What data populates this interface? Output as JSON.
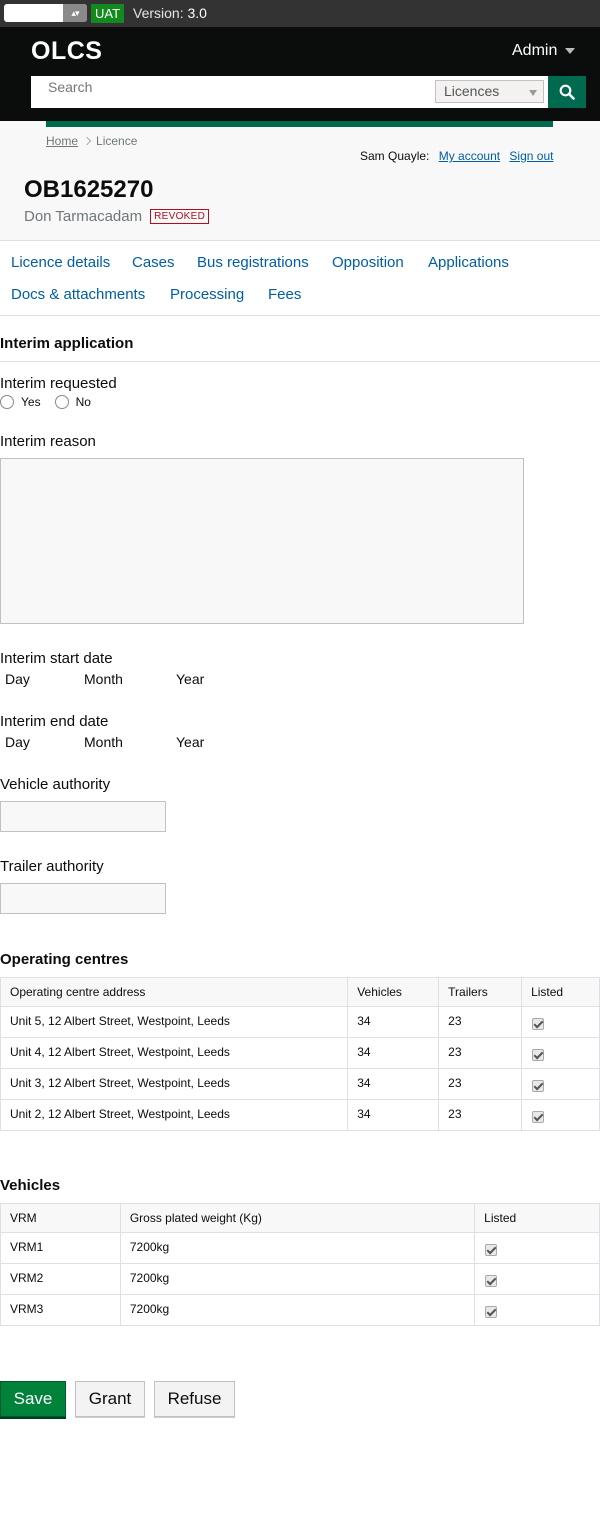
{
  "env": {
    "badge": "UAT",
    "version_label": "Version:",
    "version": "3.0"
  },
  "header": {
    "logo": "OLCS",
    "admin_label": "Admin",
    "search": {
      "placeholder": "Search",
      "scope": "Licences"
    }
  },
  "breadcrumb": {
    "home": "Home",
    "current": "Licence"
  },
  "user": {
    "name": "Sam Quayle:",
    "my_account": "My account",
    "sign_out": "Sign out"
  },
  "licence": {
    "number": "OB1625270",
    "operator": "Don Tarmacadam",
    "status": "REVOKED"
  },
  "tabs": [
    "Licence details",
    "Cases",
    "Bus registrations",
    "Opposition",
    "Applications",
    "Docs & attachments",
    "Processing",
    "Fees"
  ],
  "form": {
    "section_title": "Interim application",
    "interim_requested": {
      "label": "Interim requested",
      "yes": "Yes",
      "no": "No"
    },
    "interim_reason": {
      "label": "Interim reason",
      "value": ""
    },
    "start_date": {
      "label": "Interim start date",
      "day": "Day",
      "month": "Month",
      "year": "Year"
    },
    "end_date": {
      "label": "Interim end date",
      "day": "Day",
      "month": "Month",
      "year": "Year"
    },
    "vehicle_authority": {
      "label": "Vehicle authority",
      "value": ""
    },
    "trailer_authority": {
      "label": "Trailer authority",
      "value": ""
    }
  },
  "operating_centres": {
    "title": "Operating centres",
    "columns": [
      "Operating centre address",
      "Vehicles",
      "Trailers",
      "Listed"
    ],
    "rows": [
      {
        "address": "Unit 5, 12 Albert Street, Westpoint, Leeds",
        "vehicles": "34",
        "trailers": "23",
        "listed": true
      },
      {
        "address": "Unit 4, 12 Albert Street, Westpoint, Leeds",
        "vehicles": "34",
        "trailers": "23",
        "listed": true
      },
      {
        "address": "Unit 3, 12 Albert Street, Westpoint, Leeds",
        "vehicles": "34",
        "trailers": "23",
        "listed": true
      },
      {
        "address": "Unit 2, 12 Albert Street, Westpoint, Leeds",
        "vehicles": "34",
        "trailers": "23",
        "listed": true
      }
    ]
  },
  "vehicles": {
    "title": "Vehicles",
    "columns": [
      "VRM",
      "Gross plated weight (Kg)",
      "Listed"
    ],
    "rows": [
      {
        "vrm": "VRM1",
        "weight": "7200kg",
        "listed": true
      },
      {
        "vrm": "VRM2",
        "weight": "7200kg",
        "listed": true
      },
      {
        "vrm": "VRM3",
        "weight": "7200kg",
        "listed": true
      }
    ]
  },
  "actions": {
    "save": "Save",
    "grant": "Grant",
    "refuse": "Refuse"
  },
  "colors": {
    "brand_green": "#006a4e",
    "link_blue": "#005ea5",
    "revoked_red": "#b10e1e",
    "uat_green": "#138a1e"
  }
}
